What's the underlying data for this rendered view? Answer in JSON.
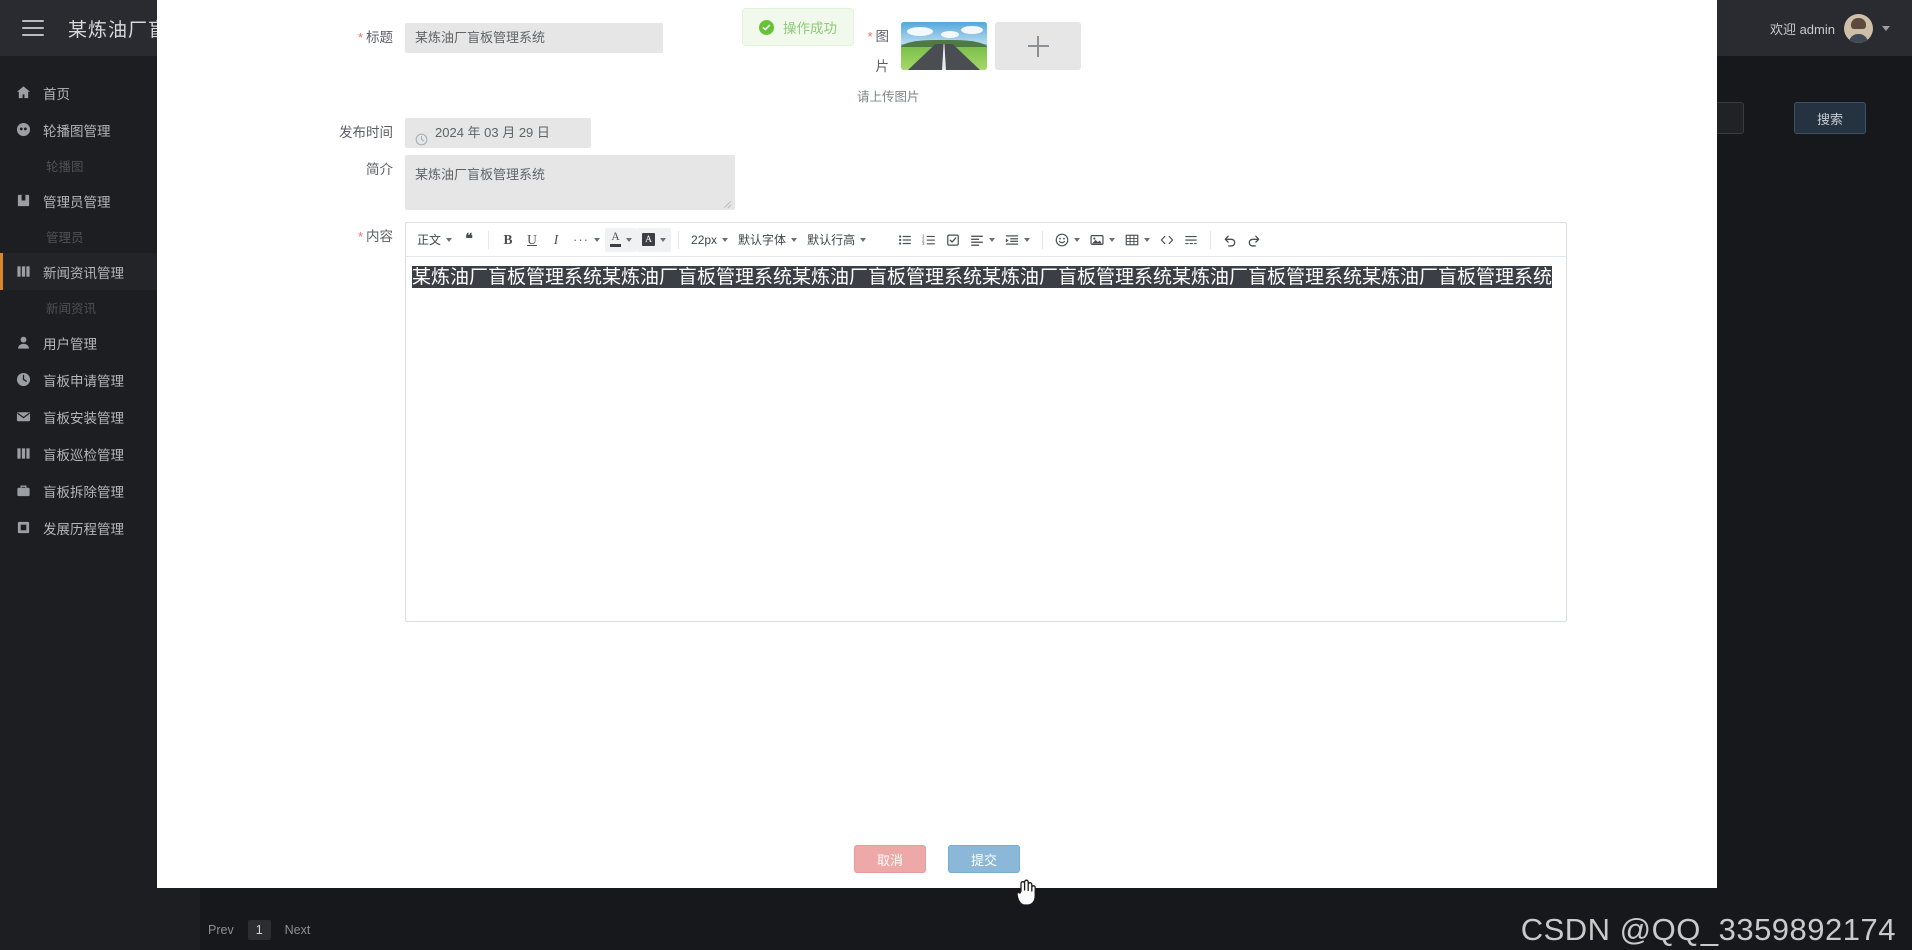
{
  "topbar": {
    "menu_icon": "hamburger-icon",
    "title": "某炼油厂盲板",
    "welcome": "欢迎 admin",
    "avatar_icon": "avatar",
    "chevron_icon": "chevron-down-icon"
  },
  "sidebar": {
    "items": [
      {
        "label": "首页",
        "icon": "home-icon",
        "arrow": "down",
        "active": false
      },
      {
        "label": "轮播图管理",
        "icon": "globe-icon",
        "arrow": "up",
        "active": false
      },
      {
        "label": "轮播图",
        "sub": true
      },
      {
        "label": "管理员管理",
        "icon": "book-icon",
        "arrow": "up",
        "active": false
      },
      {
        "label": "管理员",
        "sub": true
      },
      {
        "label": "新闻资讯管理",
        "icon": "news-icon",
        "arrow": "up",
        "active": true
      },
      {
        "label": "新闻资讯",
        "sub": true
      },
      {
        "label": "用户管理",
        "icon": "user-icon",
        "arrow": "down",
        "active": false
      },
      {
        "label": "盲板申请管理",
        "icon": "clock-icon",
        "arrow": "down",
        "active": false
      },
      {
        "label": "盲板安装管理",
        "icon": "mail-icon",
        "arrow": "down",
        "active": false
      },
      {
        "label": "盲板巡检管理",
        "icon": "news-icon",
        "arrow": "down",
        "active": false
      },
      {
        "label": "盲板拆除管理",
        "icon": "bag-icon",
        "arrow": "down",
        "active": false
      },
      {
        "label": "发展历程管理",
        "icon": "copy-icon",
        "arrow": "down",
        "active": false
      }
    ]
  },
  "background_page": {
    "search_button": "搜索",
    "pager": {
      "prev": "Prev",
      "page": "1",
      "next": "Next"
    }
  },
  "toast": {
    "message": "操作成功",
    "icon": "success-check-icon",
    "accent": "#67c23a",
    "background": "#f0f9eb"
  },
  "form": {
    "title_label": "标题",
    "title_value": "某炼油厂盲板管理系统",
    "date_label": "发布时间",
    "date_value": "2024 年 03 月 29 日",
    "date_icon": "clock-icon",
    "intro_label": "简介",
    "intro_value": "某炼油厂盲板管理系统",
    "image_label": "图片",
    "image_hint": "请上传图片",
    "upload_plus_icon": "plus-icon",
    "thumbnail_icon": "road-landscape-thumbnail",
    "content_label": "内容",
    "content_value": "某炼油厂盲板管理系统某炼油厂盲板管理系统某炼油厂盲板管理系统某炼油厂盲板管理系统某炼油厂盲板管理系统某炼油厂盲板管理系统"
  },
  "editor_toolbar": {
    "group1": [
      {
        "name": "paragraph-style-select",
        "label": "正文",
        "caret": true
      },
      {
        "name": "blockquote-button",
        "icon": "quote-icon",
        "glyph": "❝"
      }
    ],
    "group2": [
      {
        "name": "bold-button",
        "icon": "bold-icon",
        "glyph": "B"
      },
      {
        "name": "underline-button",
        "icon": "underline-icon",
        "glyph": "U"
      },
      {
        "name": "italic-button",
        "icon": "italic-icon",
        "glyph": "I"
      },
      {
        "name": "more-format-button",
        "icon": "ellipsis-icon",
        "glyph": "···",
        "caret": true
      },
      {
        "name": "text-color-button",
        "icon": "text-color-icon",
        "glyph": "A",
        "caret": true,
        "shaded": true
      },
      {
        "name": "highlight-color-button",
        "icon": "highlight-color-icon",
        "glyph": "A",
        "caret": true,
        "shaded": true
      }
    ],
    "group3": [
      {
        "name": "font-size-select",
        "label": "22px",
        "caret": true
      },
      {
        "name": "font-family-select",
        "label": "默认字体",
        "caret": true
      },
      {
        "name": "line-height-select",
        "label": "默认行高",
        "caret": true
      }
    ],
    "group4": [
      {
        "name": "bullet-list-button",
        "icon": "bullet-list-icon"
      },
      {
        "name": "ordered-list-button",
        "icon": "ordered-list-icon"
      },
      {
        "name": "todo-list-button",
        "icon": "checkbox-list-icon"
      },
      {
        "name": "align-button",
        "icon": "align-left-icon",
        "caret": true
      },
      {
        "name": "indent-button",
        "icon": "indent-icon",
        "caret": true
      }
    ],
    "group5": [
      {
        "name": "emoji-button",
        "icon": "smiley-icon",
        "caret": true
      },
      {
        "name": "insert-image-button",
        "icon": "image-icon",
        "caret": true
      },
      {
        "name": "insert-table-button",
        "icon": "table-icon",
        "caret": true
      },
      {
        "name": "code-block-button",
        "icon": "code-icon"
      },
      {
        "name": "divider-button",
        "icon": "horizontal-rule-icon"
      }
    ],
    "group6": [
      {
        "name": "undo-button",
        "icon": "undo-icon"
      },
      {
        "name": "redo-button",
        "icon": "redo-icon"
      }
    ]
  },
  "actions": {
    "cancel": "取消",
    "submit": "提交",
    "cancel_color": "#efa8a8",
    "submit_color": "#8bb8d8",
    "cursor_icon": "hand-pointer-cursor"
  },
  "watermark": "CSDN @QQ_3359892174"
}
